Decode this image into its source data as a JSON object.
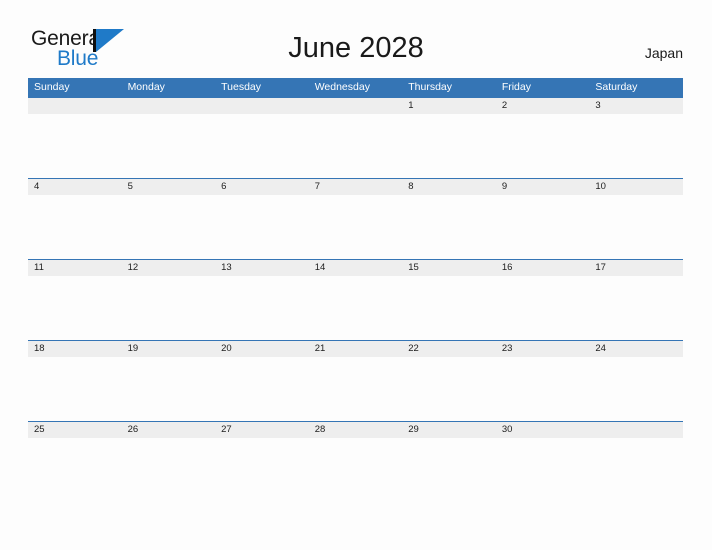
{
  "brand": {
    "name_part1": "General",
    "name_part2": "Blue",
    "mark": "triangle-flag-icon",
    "colors": {
      "black": "#1a1a1a",
      "blue": "#1f7ac8"
    }
  },
  "header": {
    "title": "June 2028",
    "locale": "Japan"
  },
  "calendar": {
    "month": "June",
    "year": "2028",
    "country": "Japan",
    "accent_color": "#3575b5",
    "band_color": "#eeeeee",
    "weekdays": [
      "Sunday",
      "Monday",
      "Tuesday",
      "Wednesday",
      "Thursday",
      "Friday",
      "Saturday"
    ],
    "weeks": [
      {
        "days": [
          {
            "date": ""
          },
          {
            "date": ""
          },
          {
            "date": ""
          },
          {
            "date": ""
          },
          {
            "date": "1"
          },
          {
            "date": "2"
          },
          {
            "date": "3"
          }
        ]
      },
      {
        "days": [
          {
            "date": "4"
          },
          {
            "date": "5"
          },
          {
            "date": "6"
          },
          {
            "date": "7"
          },
          {
            "date": "8"
          },
          {
            "date": "9"
          },
          {
            "date": "10"
          }
        ]
      },
      {
        "days": [
          {
            "date": "11"
          },
          {
            "date": "12"
          },
          {
            "date": "13"
          },
          {
            "date": "14"
          },
          {
            "date": "15"
          },
          {
            "date": "16"
          },
          {
            "date": "17"
          }
        ]
      },
      {
        "days": [
          {
            "date": "18"
          },
          {
            "date": "19"
          },
          {
            "date": "20"
          },
          {
            "date": "21"
          },
          {
            "date": "22"
          },
          {
            "date": "23"
          },
          {
            "date": "24"
          }
        ]
      },
      {
        "days": [
          {
            "date": "25"
          },
          {
            "date": "26"
          },
          {
            "date": "27"
          },
          {
            "date": "28"
          },
          {
            "date": "29"
          },
          {
            "date": "30"
          },
          {
            "date": ""
          }
        ]
      }
    ]
  }
}
